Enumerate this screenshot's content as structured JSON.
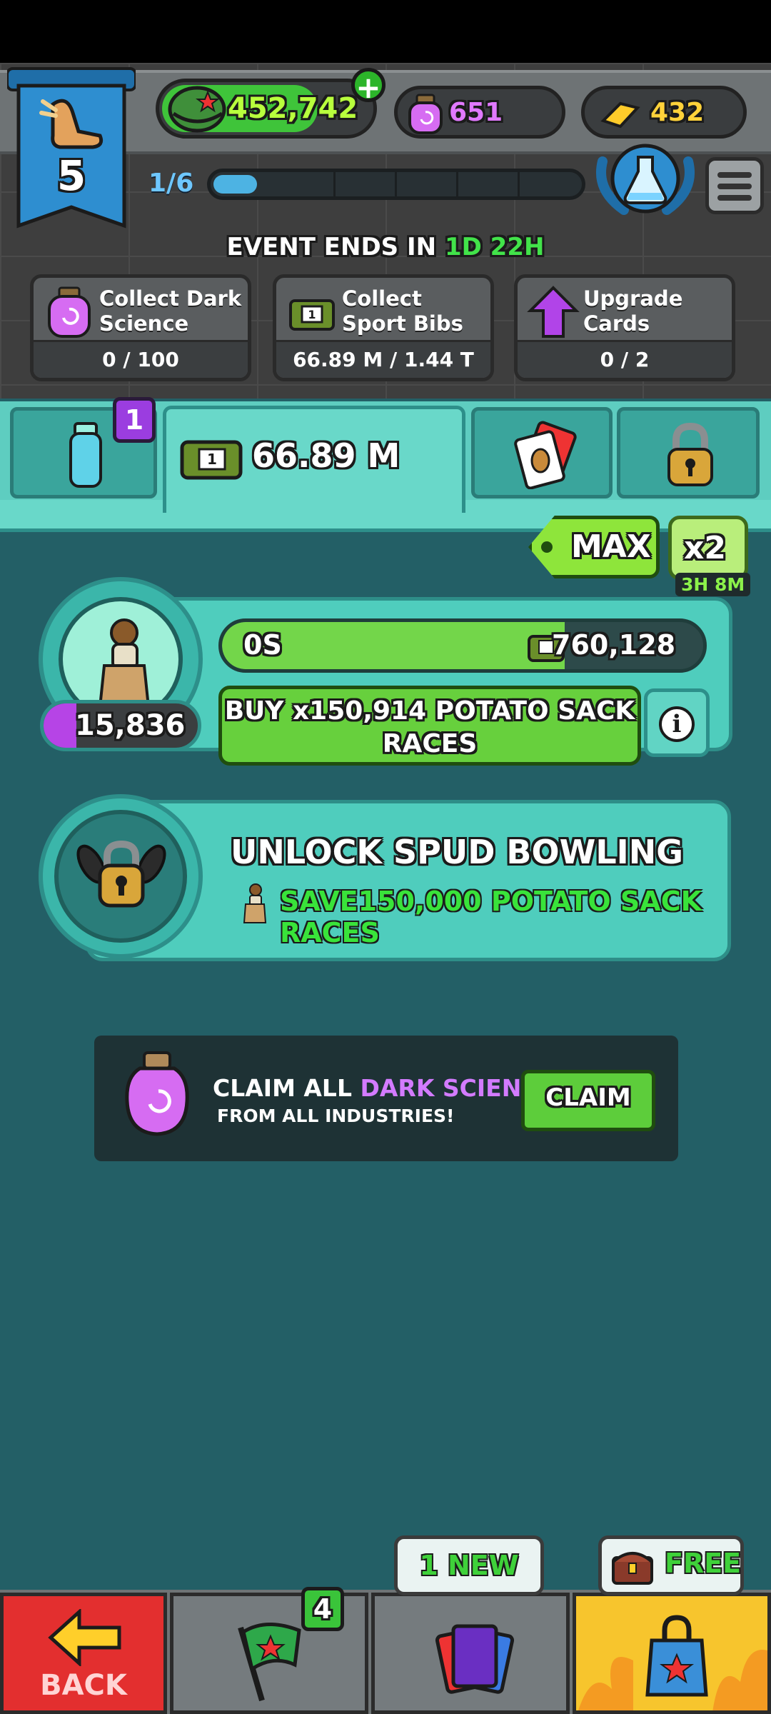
{
  "header": {
    "level": "5",
    "money": "452,742",
    "dark_science": "651",
    "gold": "432",
    "progress_label": "1/6",
    "progress_fraction": 0.12
  },
  "event": {
    "prefix": "EVENT ENDS IN",
    "time": "1D 22H",
    "tasks": [
      {
        "title": "Collect Dark Science",
        "progress": "0 / 100",
        "icon": "dark-science-jar-icon"
      },
      {
        "title": "Collect Sport Bibs",
        "progress": "66.89 M / 1.44 T",
        "icon": "sport-bibs-icon"
      },
      {
        "title": "Upgrade Cards",
        "progress": "0 / 2",
        "icon": "upgrade-arrow-icon"
      }
    ]
  },
  "tabs": {
    "badge": "1",
    "active_value": "66.89 M"
  },
  "multiplier": {
    "max_label": "MAX",
    "boost_label": "x2",
    "boost_timer": "3H 8M"
  },
  "industry": {
    "owned_count": "15,836",
    "rate_left": "0S",
    "rate_right": "760,128",
    "buy_label": "BUY x150,914 POTATO SACK RACES"
  },
  "unlock": {
    "title": "UNLOCK SPUD BOWLING",
    "subtitle": "SAVE150,000 POTATO SACK RACES"
  },
  "claim": {
    "line1_prefix": "CLAIM ALL ",
    "line1_highlight": "DARK SCIENCE",
    "line2": "FROM ALL INDUSTRIES!",
    "button": "CLAIM"
  },
  "bottom_nav": {
    "back": "BACK",
    "flag_badge": "4",
    "cards_bubble": "1 NEW",
    "shop_bubble": "FREE"
  },
  "colors": {
    "accent_green": "#42e34a",
    "panel_teal": "#4fcdbd",
    "purple": "#b644e6",
    "back_red": "#e32f2f",
    "shop_yellow": "#f7c52d"
  }
}
